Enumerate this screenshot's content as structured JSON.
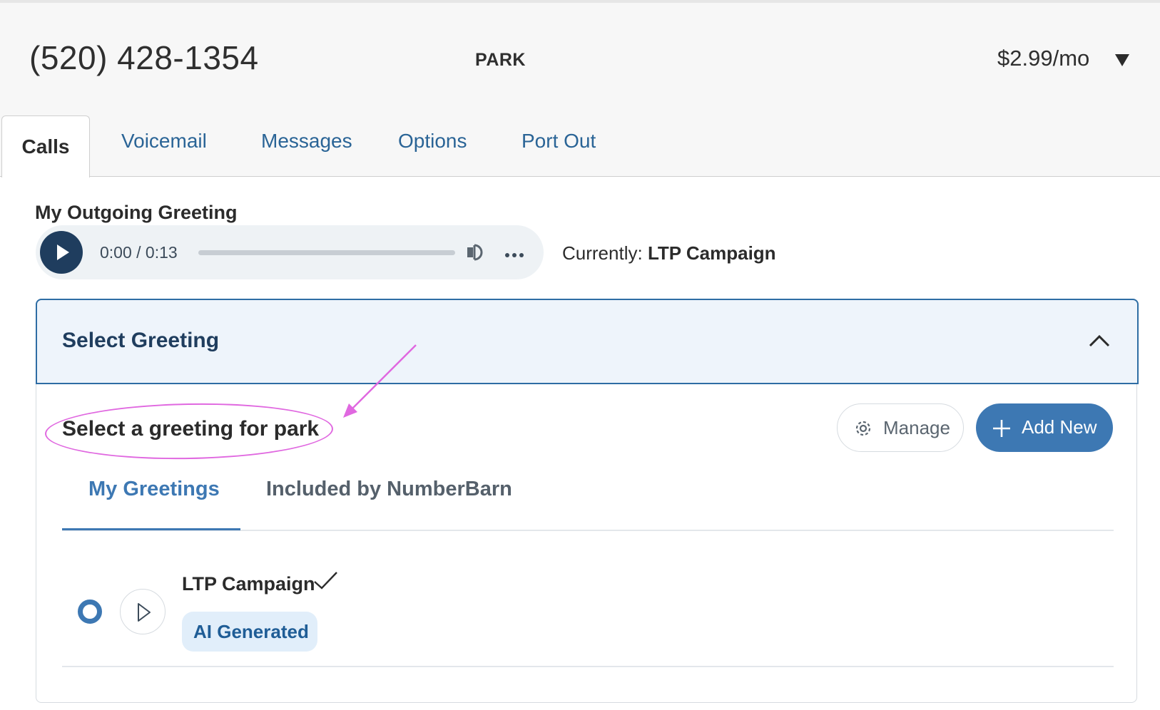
{
  "header": {
    "phone_number": "(520) 428-1354",
    "label": "PARK",
    "price": "$2.99/mo",
    "price_menu_icon": "caret-down-icon"
  },
  "tabs": [
    {
      "label": "Calls",
      "active": true
    },
    {
      "label": "Voicemail",
      "active": false
    },
    {
      "label": "Messages",
      "active": false
    },
    {
      "label": "Options",
      "active": false
    },
    {
      "label": "Port Out",
      "active": false
    }
  ],
  "outgoing_greeting": {
    "title": "My Outgoing Greeting",
    "player": {
      "time": "0:00 / 0:13",
      "progress": 0,
      "icons": [
        "play-icon",
        "volume-icon",
        "more-options-icon"
      ]
    },
    "currently_prefix": "Currently:",
    "currently_value": "LTP Campaign"
  },
  "select_greeting": {
    "title": "Select Greeting",
    "expanded": true,
    "instruction": "Select a greeting for park",
    "manage_label": "Manage",
    "add_new_label": "Add New",
    "subtabs": [
      {
        "label": "My Greetings",
        "active": true
      },
      {
        "label": "Included by NumberBarn",
        "active": false
      }
    ],
    "greetings": [
      {
        "name": "LTP Campaign",
        "selected": true,
        "badge": "AI Generated"
      }
    ]
  },
  "colors": {
    "accent": "#3d78b3",
    "dark_navy": "#1f3d5e",
    "annotation": "#e068e0",
    "header_bg": "#f7f7f7",
    "panel_head_bg": "#eef4fb"
  }
}
